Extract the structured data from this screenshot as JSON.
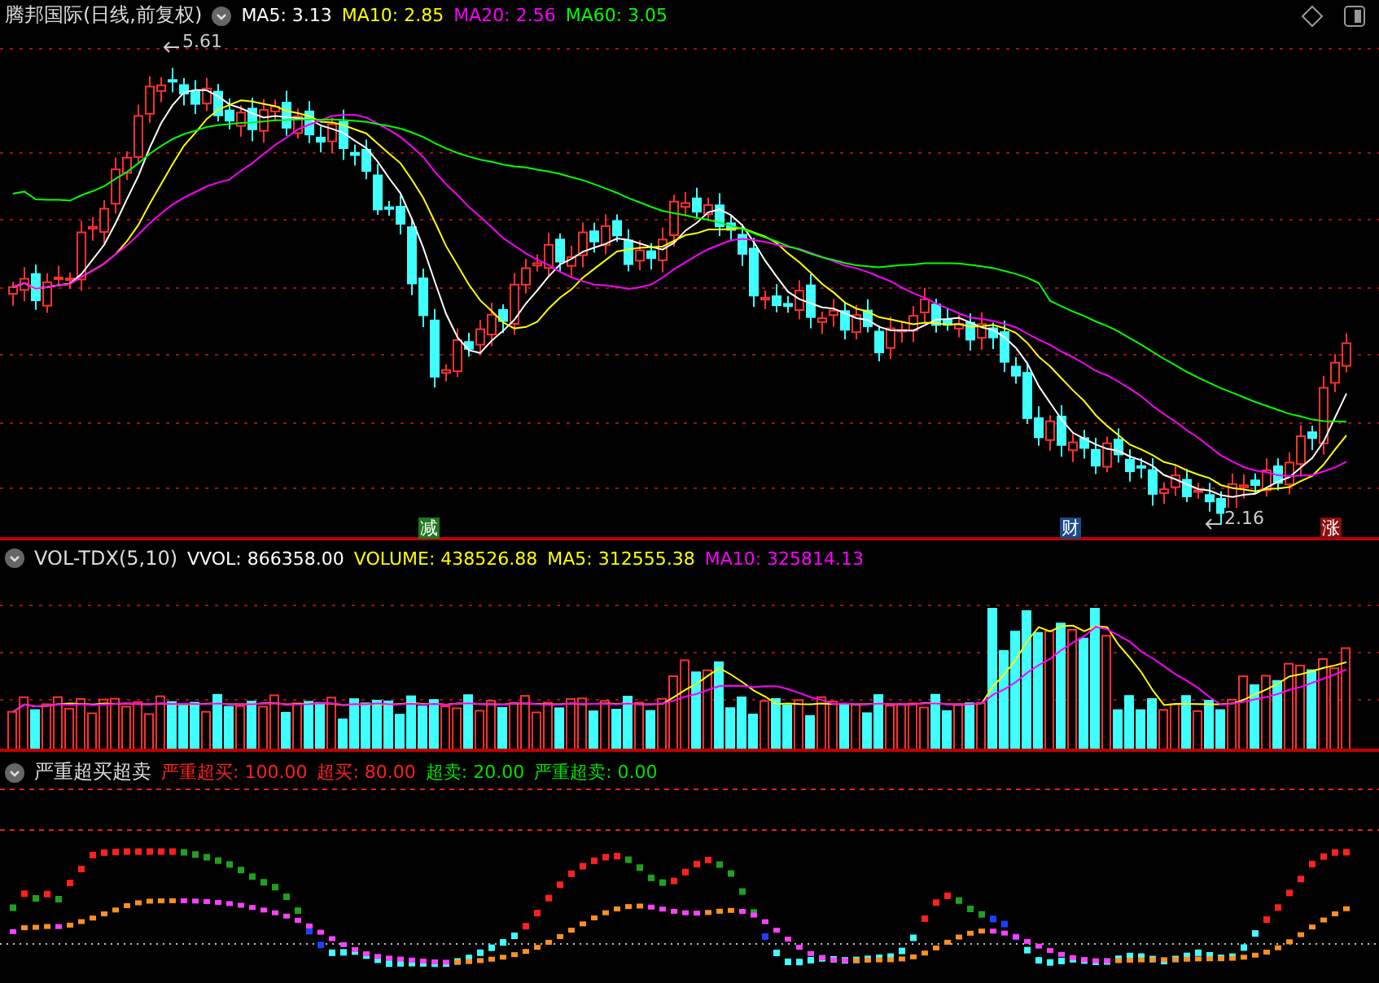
{
  "window": {
    "title": "腾邦国际(日线,前复权)"
  },
  "main_panel": {
    "legend": [
      {
        "label": "MA5: 3.13",
        "color": "#ffffff"
      },
      {
        "label": "MA10: 2.85",
        "color": "#ffff00"
      },
      {
        "label": "MA20: 2.56",
        "color": "#ff00ff"
      },
      {
        "label": "MA60: 3.05",
        "color": "#00ff00"
      }
    ],
    "high_marker": "5.61",
    "low_marker": "2.16",
    "event_tags": [
      {
        "label": "减",
        "color": "#1e7a1e"
      },
      {
        "label": "财",
        "color": "#1a4a8a"
      },
      {
        "label": "涨",
        "color": "#8a1010"
      }
    ]
  },
  "volume_panel": {
    "title": "VOL-TDX(5,10)",
    "legend": [
      {
        "label": "VVOL: 866358.00",
        "color": "#ffffff"
      },
      {
        "label": "VOLUME: 438526.88",
        "color": "#ffff00"
      },
      {
        "label": "MA5: 312555.38",
        "color": "#ffff00"
      },
      {
        "label": "MA10: 325814.13",
        "color": "#ff00ff"
      }
    ]
  },
  "oscillator_panel": {
    "title": "严重超买超卖",
    "legend": [
      {
        "label": "严重超买: 100.00",
        "color": "#ff2020"
      },
      {
        "label": "超买: 80.00",
        "color": "#ff2020"
      },
      {
        "label": "超卖: 20.00",
        "color": "#00e000"
      },
      {
        "label": "严重超卖: 0.00",
        "color": "#00e000"
      }
    ]
  }
}
